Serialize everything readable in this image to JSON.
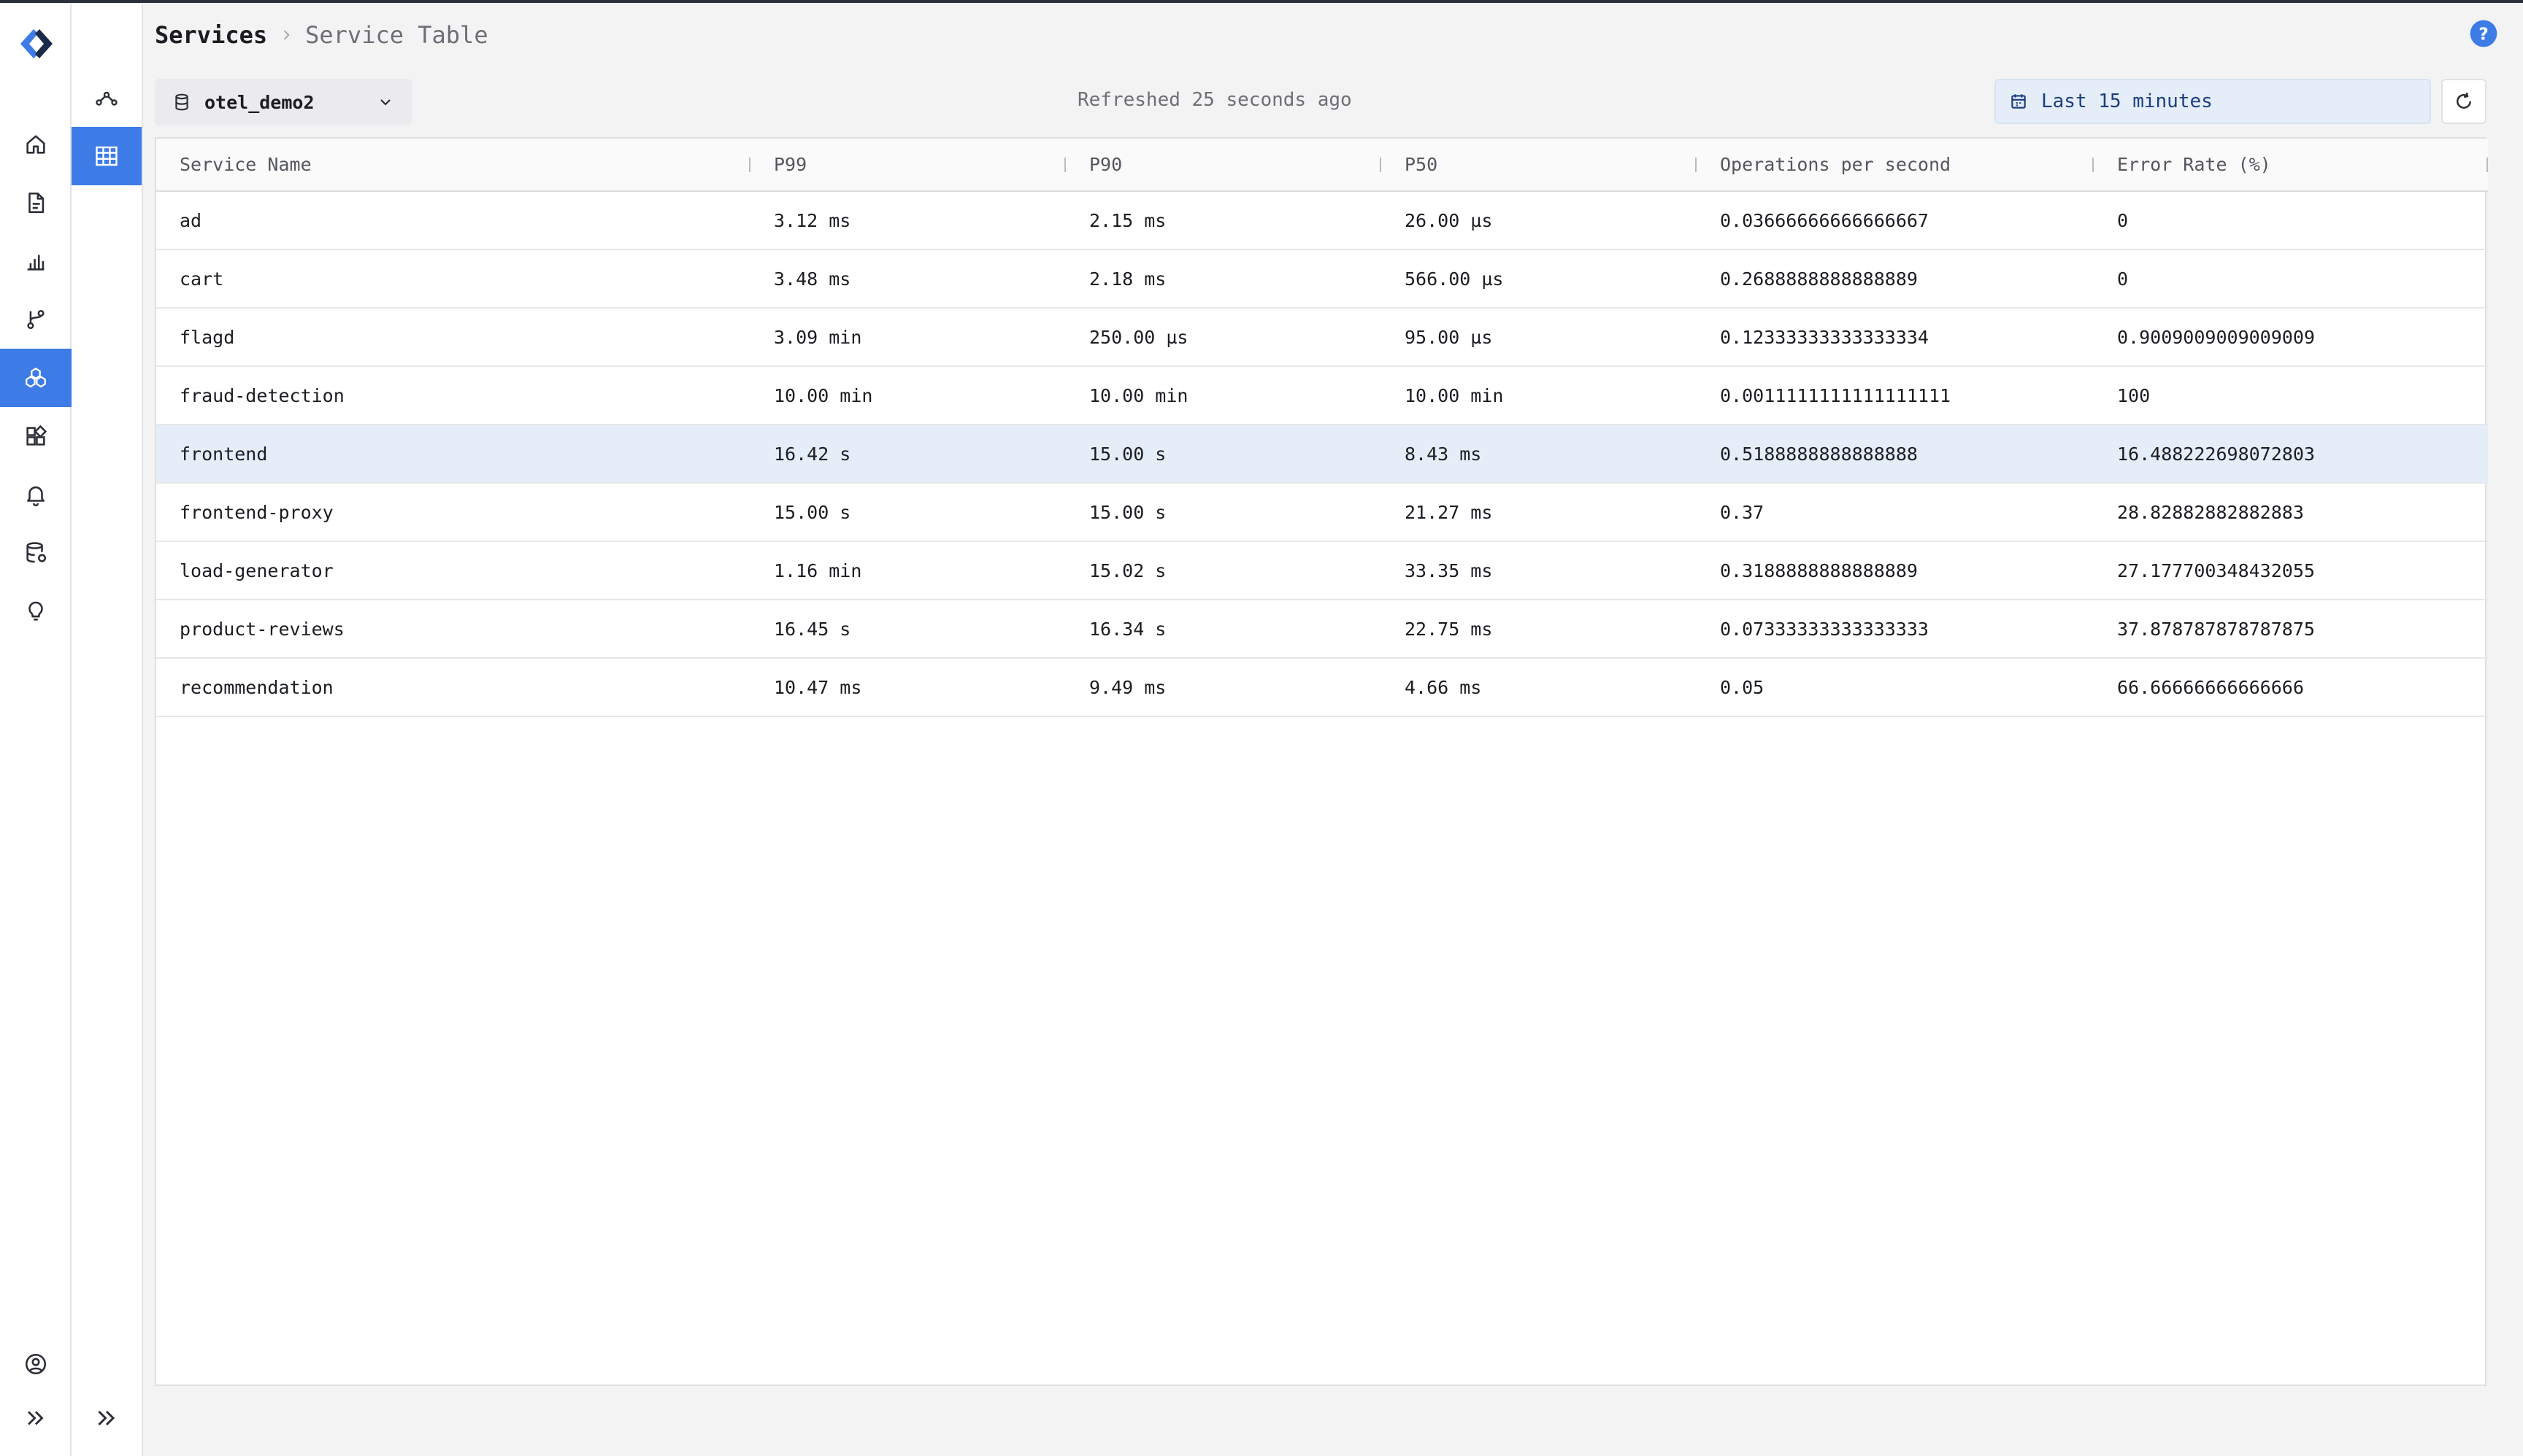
{
  "breadcrumb": {
    "root": "Services",
    "current": "Service Table"
  },
  "datasource": {
    "name": "otel_demo2"
  },
  "status": {
    "refreshed": "Refreshed 25 seconds ago"
  },
  "time_range": {
    "label": "Last 15 minutes"
  },
  "colors": {
    "accent": "#3d7be6",
    "selected_row": "#e5edf8",
    "time_range_bg": "#e5edf8"
  },
  "table": {
    "columns": [
      "Service Name",
      "P99",
      "P90",
      "P50",
      "Operations per second",
      "Error Rate (%)"
    ],
    "selected_row": 4,
    "rows": [
      [
        "ad",
        "3.12 ms",
        "2.15 ms",
        "26.00 µs",
        "0.03666666666666667",
        "0"
      ],
      [
        "cart",
        "3.48 ms",
        "2.18 ms",
        "566.00 µs",
        "0.2688888888888889",
        "0"
      ],
      [
        "flagd",
        "3.09 min",
        "250.00 µs",
        "95.00 µs",
        "0.12333333333333334",
        "0.9009009009009009"
      ],
      [
        "fraud-detection",
        "10.00 min",
        "10.00 min",
        "10.00 min",
        "0.0011111111111111111",
        "100"
      ],
      [
        "frontend",
        "16.42 s",
        "15.00 s",
        "8.43 ms",
        "0.5188888888888888",
        "16.488222698072803"
      ],
      [
        "frontend-proxy",
        "15.00 s",
        "15.00 s",
        "21.27 ms",
        "0.37",
        "28.82882882882883"
      ],
      [
        "load-generator",
        "1.16 min",
        "15.02 s",
        "33.35 ms",
        "0.3188888888888889",
        "27.177700348432055"
      ],
      [
        "product-reviews",
        "16.45 s",
        "16.34 s",
        "22.75 ms",
        "0.07333333333333333",
        "37.878787878787875"
      ],
      [
        "recommendation",
        "10.47 ms",
        "9.49 ms",
        "4.66 ms",
        "0.05",
        "66.66666666666666"
      ]
    ]
  },
  "icons": {
    "rail": [
      "logo-icon",
      "home-icon",
      "document-icon",
      "bar-chart-icon",
      "git-branch-icon",
      "services-icon",
      "dashboards-icon",
      "bell-icon",
      "database-icon",
      "lightbulb-icon",
      "user-circle-icon",
      "expand-icon"
    ],
    "subrail": [
      "service-map-icon",
      "table-icon",
      "expand-icon"
    ]
  }
}
